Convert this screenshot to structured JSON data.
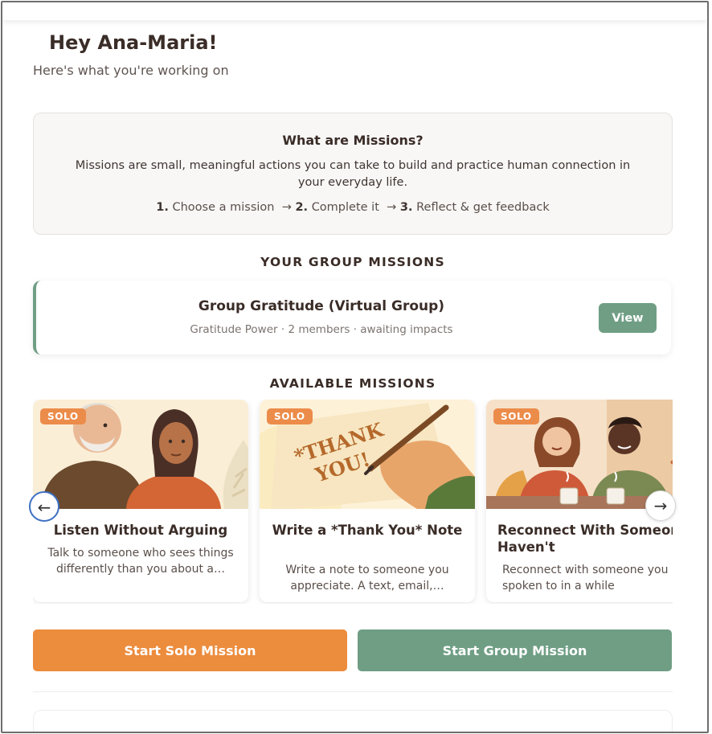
{
  "header": {
    "greeting": "Hey Ana-Maria!",
    "subtitle": "Here's what you're working on"
  },
  "info": {
    "title": "What are Missions?",
    "description": "Missions are small, meaningful actions you can take to build and practice human connection in your everyday life.",
    "steps": [
      {
        "num": "1.",
        "label": "Choose a mission"
      },
      {
        "num": "2.",
        "label": "Complete it"
      },
      {
        "num": "3.",
        "label": "Reflect & get feedback"
      }
    ],
    "arrow": "→"
  },
  "group_missions": {
    "heading": "YOUR GROUP MISSIONS",
    "items": [
      {
        "title": "Group Gratitude (Virtual Group)",
        "meta": "Gratitude Power · 2 members · awaiting impacts",
        "button": "View"
      }
    ]
  },
  "available_missions": {
    "heading": "AVAILABLE MISSIONS",
    "cards": [
      {
        "badge": "SOLO",
        "title": "Listen Without Arguing",
        "description": "Talk to someone who sees things differently than you about a…"
      },
      {
        "badge": "SOLO",
        "title": "Write a *Thank You* Note",
        "description": "Write a note to someone you appreciate. A text, email,…",
        "art_text": "*THANK YOU!"
      },
      {
        "badge": "SOLO",
        "title": "Reconnect With Someone You Haven't",
        "description": "Reconnect with someone you haven't spoken to in a while"
      }
    ],
    "prev_icon": "←",
    "next_icon": "→"
  },
  "actions": {
    "solo": "Start Solo Mission",
    "group": "Start Group Mission"
  },
  "colors": {
    "accent_orange": "#ec8c3d",
    "accent_green": "#6f9e84",
    "text_dark": "#3a2c27"
  }
}
